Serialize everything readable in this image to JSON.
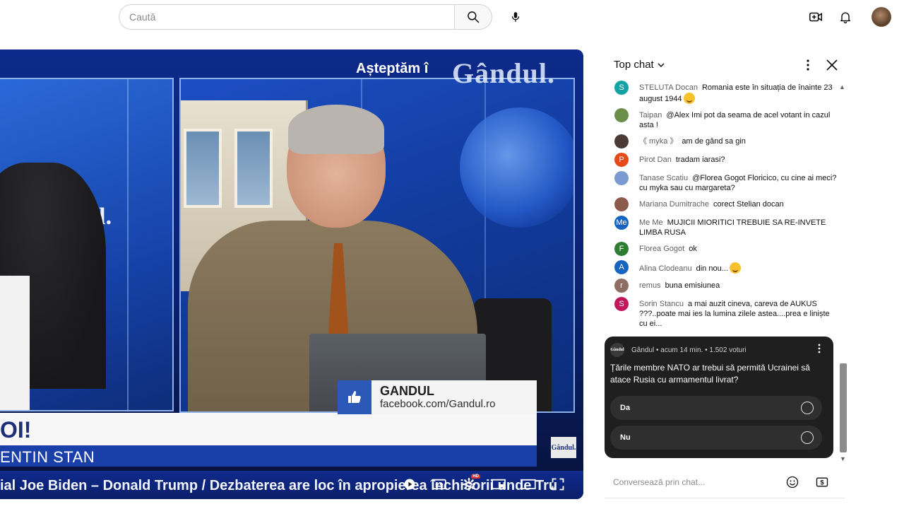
{
  "search": {
    "placeholder": "Caută"
  },
  "icons": {
    "search": "search-icon",
    "mic": "microphone-icon",
    "create": "create-video-icon",
    "notifications": "bell-icon",
    "avatar": "user-avatar"
  },
  "video": {
    "overlay_top_text": "Așteptăm î",
    "logo_text": "Gândul.",
    "left_logo_text": "Gândul.",
    "lower_title": "OI!",
    "name_strip": "ENTIN STAN",
    "ticker": "ial Joe Biden – Donald Trump / Dezbaterea are loc în apropierea închisorii unde Tru",
    "fb_card": {
      "title": "GANDUL",
      "url": "facebook.com/Gandul.ro"
    },
    "small_logo": "Gândul.",
    "controls": [
      "play-icon",
      "subtitles-icon",
      "settings-icon",
      "miniplayer-icon",
      "theater-icon",
      "fullscreen-icon"
    ],
    "settings_badge": "HD"
  },
  "chat": {
    "header": "Top chat",
    "messages": [
      {
        "initial": "S",
        "color": "#12a4a4",
        "author": "STELUTA Docan",
        "text": "Romania este în situația de înainte 23 august 1944",
        "emoji": true
      },
      {
        "initial": "",
        "color": "#6b8f4a",
        "author": "Taipan",
        "text": "@Alex Imi pot da seama de acel votant in cazul asta !",
        "emoji": false
      },
      {
        "initial": "",
        "color": "#4a3c35",
        "author": "《 myka 》",
        "text": "am de gând sa gin",
        "emoji": false
      },
      {
        "initial": "P",
        "color": "#e64a19",
        "author": "Pirot Dan",
        "text": "tradam iarasi?",
        "emoji": false
      },
      {
        "initial": "",
        "color": "#7a9bd1",
        "author": "Tanase Scatiu",
        "text": "@Florea Gogot Floricico, cu cine ai meci? cu myka sau cu margareta?",
        "emoji": false
      },
      {
        "initial": "",
        "color": "#8b5a4a",
        "author": "Mariana Dumitrache",
        "text": "corect Stelian docan",
        "emoji": false
      },
      {
        "initial": "Me",
        "color": "#1565c0",
        "author": "Me Me",
        "text": "MUJICII MIORITICI TREBUIE SA RE-INVETE LIMBA RUSA",
        "emoji": false
      },
      {
        "initial": "F",
        "color": "#2e7d32",
        "author": "Florea Gogot",
        "text": "ok",
        "emoji": false
      },
      {
        "initial": "A",
        "color": "#1565c0",
        "author": "Alina Clodeanu",
        "text": "din nou...",
        "emoji": true
      },
      {
        "initial": "r",
        "color": "#8d6e63",
        "author": "remus",
        "text": "buna emisiunea",
        "emoji": false
      },
      {
        "initial": "S",
        "color": "#c2185b",
        "author": "Sorin Stancu",
        "text": "a mai auzit cineva, careva de AUKUS ???..poate mai ies la lumina zilele astea....prea e liniște cu ei...",
        "emoji": false
      }
    ],
    "poll": {
      "logo_text": "Gândul",
      "meta": "Gândul • acum 14 min. • 1.502 voturi",
      "question": "Țările membre NATO ar trebui să permită Ucrainei să atace Rusia cu armamentul livrat?",
      "options": [
        "Da",
        "Nu"
      ]
    },
    "input": {
      "placeholder": "Conversează prin chat..."
    }
  }
}
